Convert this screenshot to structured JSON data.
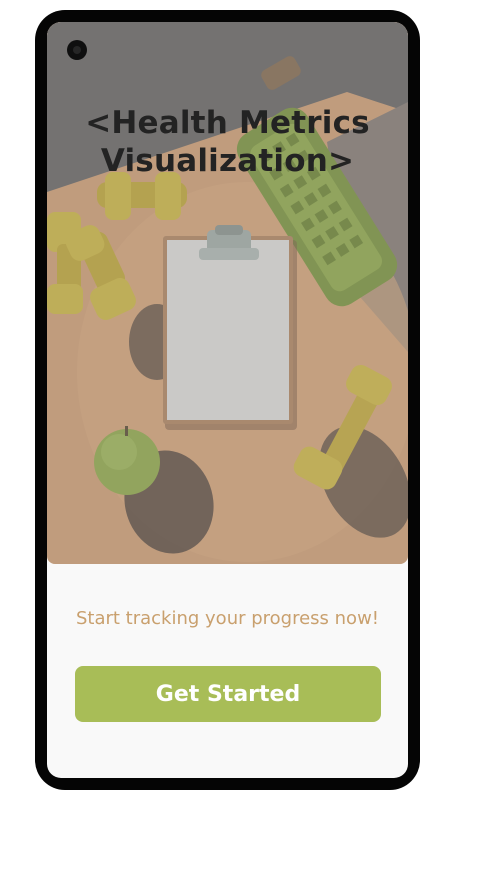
{
  "hero": {
    "title_line1": "<Health Metrics",
    "title_line2": "Visualization>"
  },
  "tagline": "Start tracking your progress now!",
  "cta": {
    "label": "Get Started"
  },
  "colors": {
    "accent": "#a8bd57",
    "tagline": "#c9a06e",
    "title": "#232323",
    "frame": "#050505",
    "screen": "#f9f9f9"
  }
}
